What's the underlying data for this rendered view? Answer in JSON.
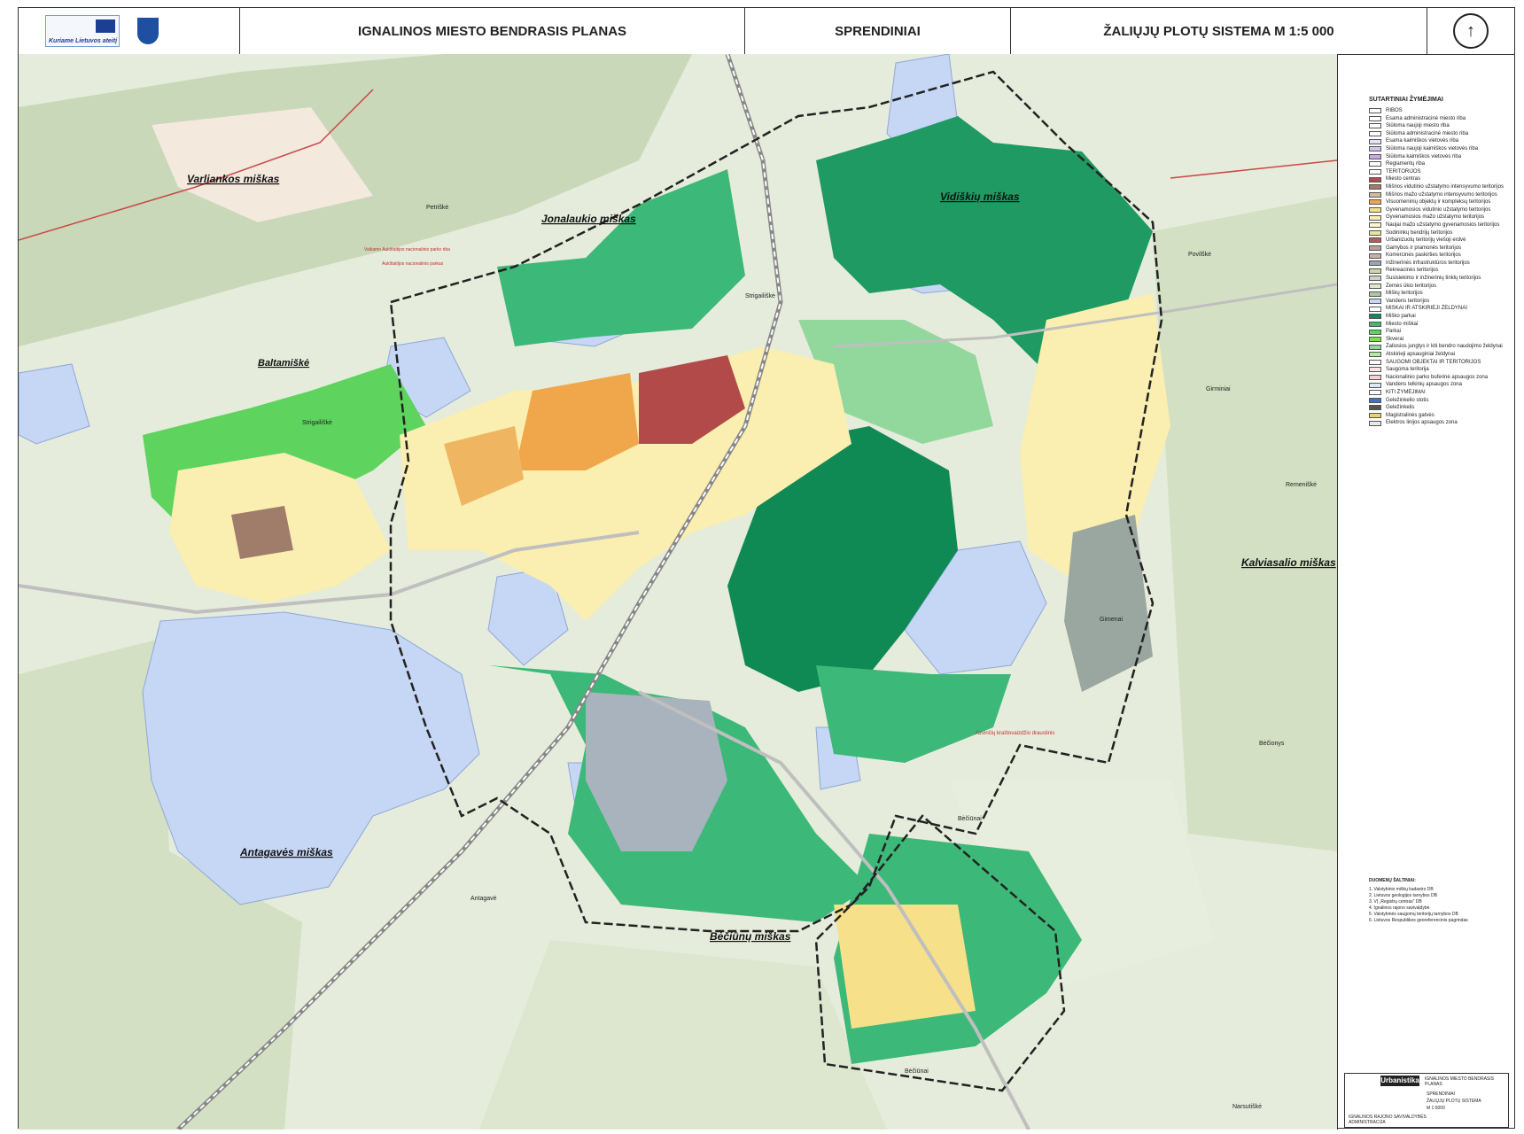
{
  "header": {
    "eu_logo_text": "Kuriame Lietuvos ateitį",
    "title": "IGNALINOS MIESTO BENDRASIS PLANAS",
    "section": "SPRENDINIAI",
    "sheet": "ŽALIŲJŲ PLOTŲ SISTEMA   M 1:5 000"
  },
  "map": {
    "place_labels": {
      "varliankos": "Varliankos miškas",
      "jonalaukio": "Jonalaukio miškas",
      "vidiskiu": "Vidiškių miškas",
      "baltamiske": "Baltamiškė",
      "kalviasalio": "Kalviasalio miškas",
      "antagaves": "Antagavės miškas",
      "beciunu": "Bėčiūnų miškas",
      "petriske": "Petriškė",
      "povilske": "Povilškė",
      "girminiai": "Girminiai",
      "remeniske": "Remeniškė",
      "beciunai": "Bėčiūnai",
      "beciunai2": "Bėčiūnai",
      "beciunys": "Bėčionys",
      "antagave": "Antagavė",
      "narsutiske": "Narsutiškė",
      "strigailiske": "Strigailiškė",
      "strigailiske2": "Strigailiškė",
      "gimenai": "Gimenai",
      "reserve": "Azvinčių kraštovaizdžio draustinis",
      "park1": "Aukštaitijos nacionalinis parkas",
      "park2": "Vaikamo Aukštaitijos nacionalinio parko riba"
    }
  },
  "legend": {
    "title": "SUTARTINIAI ŽYMĖJIMAI",
    "items": [
      {
        "label": "RIBOS",
        "color": "#ffffff"
      },
      {
        "label": "Esama administracinė miesto riba",
        "color": "#ffffff"
      },
      {
        "label": "Siūloma naujoji miesto riba",
        "color": "#ffffff"
      },
      {
        "label": "Siūloma administracinė miesto riba",
        "color": "#ffffff"
      },
      {
        "label": "Esama kaimiškos vietovės riba",
        "color": "#e9e0f4"
      },
      {
        "label": "Siūloma naujoji kaimiškos vietovės riba",
        "color": "#d6c3ec"
      },
      {
        "label": "Siūloma kaimiškos vietovės riba",
        "color": "#c4a9e4"
      },
      {
        "label": "Reglamentų riba",
        "color": "#ffffff"
      },
      {
        "label": "TERITORIJOS",
        "color": "#ffffff"
      },
      {
        "label": "Miesto centras",
        "color": "#b24a4a"
      },
      {
        "label": "Mišrios vidutinio užstatymo intensyvumo teritorijos",
        "color": "#a07d6b"
      },
      {
        "label": "Mišrios mažo užstatymo intensyvumo teritorijos",
        "color": "#d8b89c"
      },
      {
        "label": "Visuomeninių objektų ir kompleksų teritorijos",
        "color": "#f0a64a"
      },
      {
        "label": "Gyvenamosios vidutinio užstatymo teritorijos",
        "color": "#f6e08a"
      },
      {
        "label": "Gyvenamosios mažo užstatymo teritorijos",
        "color": "#faeeb0"
      },
      {
        "label": "Naujai mažo užstatymo gyvenamosios teritorijos",
        "color": "#fdf6d0"
      },
      {
        "label": "Sodininkų bendrijų teritorijos",
        "color": "#e4e89a"
      },
      {
        "label": "Urbanizuotų teritorijų viešoji erdvė",
        "color": "#b85a5a"
      },
      {
        "label": "Gamybos ir pramonės teritorijos",
        "color": "#b2a39a"
      },
      {
        "label": "Komercinės paskirties teritorijos",
        "color": "#c9b2a8"
      },
      {
        "label": "Inžinerinės infrastruktūros teritorijos",
        "color": "#9aa6b0"
      },
      {
        "label": "Rekreacinės teritorijos",
        "color": "#c4dca0"
      },
      {
        "label": "Susisiekimo ir inžinerinių tinklų teritorijos",
        "color": "#cfcfcf"
      },
      {
        "label": "Žemės ūkio teritorijos",
        "color": "#dfe9c8"
      },
      {
        "label": "Miškų teritorijos",
        "color": "#a9c9a0"
      },
      {
        "label": "Vandens teritorijos",
        "color": "#c8d8f4"
      },
      {
        "label": "MIŠKAI IR ATSKIRIEJI ŽELDYNAI",
        "color": "#ffffff"
      },
      {
        "label": "Miško parkai",
        "color": "#0f8a55"
      },
      {
        "label": "Miesto miškai",
        "color": "#3cb878"
      },
      {
        "label": "Parkai",
        "color": "#5ed35e"
      },
      {
        "label": "Skverai",
        "color": "#78e24c"
      },
      {
        "label": "Žaliosios jungtys ir kiti bendro naudojimo želdynai",
        "color": "#92d89c"
      },
      {
        "label": "Atskirieji apsauginiai želdynai",
        "color": "#b6e8a0"
      },
      {
        "label": "SAUGOMI OBJEKTAI IR TERITORIJOS",
        "color": "#ffffff"
      },
      {
        "label": "Saugoma teritorija",
        "color": "#fbe4e4"
      },
      {
        "label": "Nacionalinio parko buferinė apsaugos zona",
        "color": "#f3d2d2"
      },
      {
        "label": "Vandens telkinių apsaugos zona",
        "color": "#dbe9f7"
      },
      {
        "label": "KITI ŽYMĖJIMAI",
        "color": "#ffffff"
      },
      {
        "label": "Geležinkelio stotis",
        "color": "#4a6fc2"
      },
      {
        "label": "Geležinkelis",
        "color": "#555555"
      },
      {
        "label": "Magistralinės gatvės",
        "color": "#e6d36a"
      },
      {
        "label": "Elektros linijos apsaugos zona",
        "color": "#e8e8e8"
      }
    ]
  },
  "sources": {
    "title": "DUOMENŲ ŠALTINIAI:",
    "lines": [
      "1. Valstybinio miškų kadastro DB",
      "2. Lietuvos geologijos tarnybos DB",
      "3. VĮ „Registrų centras“ DB",
      "4. Ignalinos rajono savivaldybė",
      "5. Valstybinės saugomų teritorijų tarnybos DB",
      "6. Lietuvos Respublikos georeferencinis pagrindas"
    ]
  },
  "titleblock": {
    "company": "Urbanistika",
    "project": "IGNALINOS MIESTO BENDRASIS PLANAS",
    "section": "SPRENDINIAI",
    "sheet": "ŽALIŲJŲ PLOTŲ SISTEMA",
    "scale": "M 1:5000",
    "client": "IGNALINOS RAJONO SAVIVALDYBĖS ADMINISTRACIJA"
  }
}
